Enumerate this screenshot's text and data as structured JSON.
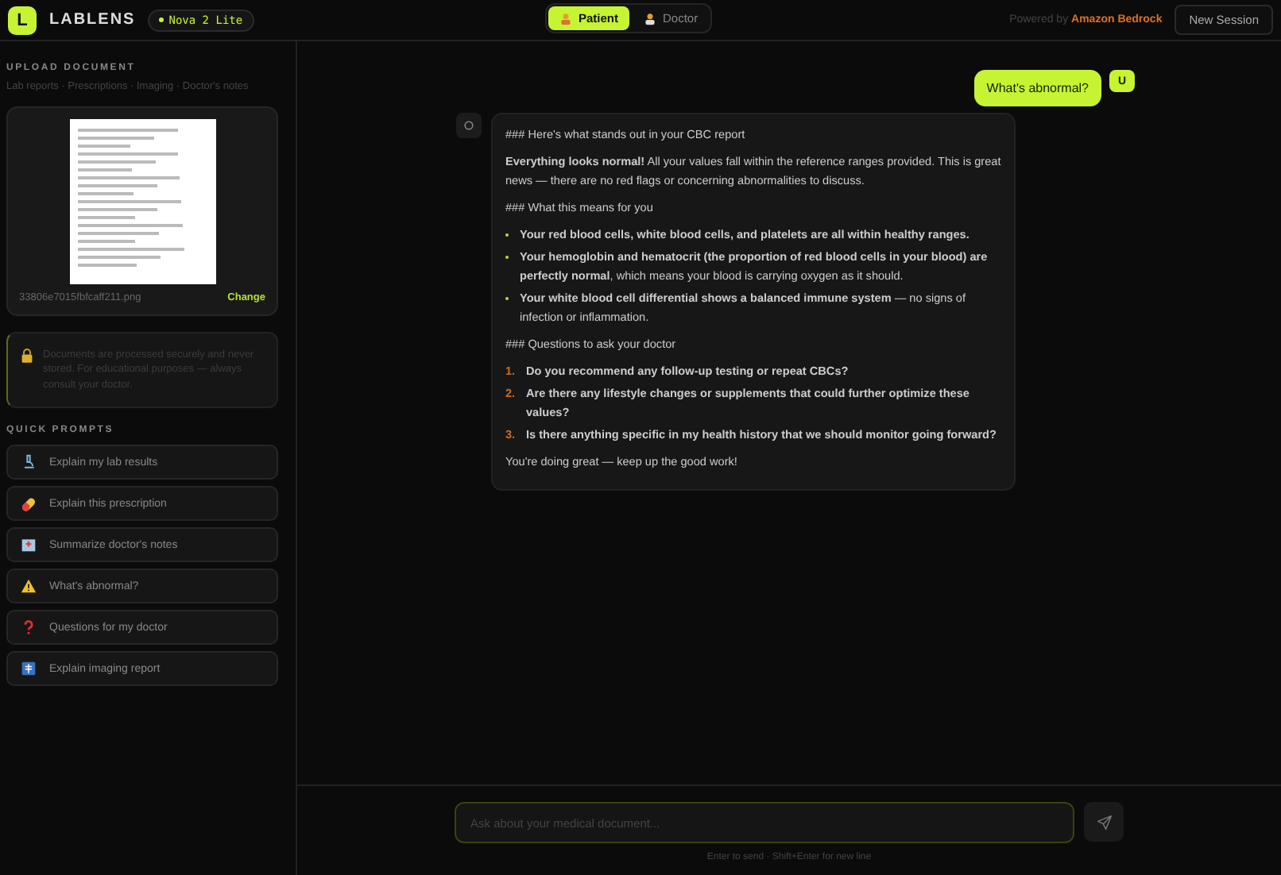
{
  "header": {
    "logo_letter": "L",
    "brand": "LABLENS",
    "model_badge": "Nova 2 Lite",
    "mode_tabs": [
      {
        "label": "Patient",
        "kind": "patient",
        "selected": true
      },
      {
        "label": "Doctor",
        "kind": "doctor",
        "selected": false
      }
    ],
    "powered_prefix": "Powered by",
    "powered_name": "Amazon Bedrock",
    "new_session": "New Session"
  },
  "sidebar": {
    "upload_title": "UPLOAD DOCUMENT",
    "upload_subtitle": "Lab reports · Prescriptions · Imaging · Doctor's notes",
    "file": {
      "name": "33806e7015fbfcaff211.png",
      "action": "Change"
    },
    "notice": "Documents are processed securely and never stored. For educational purposes — always consult your doctor.",
    "quick_prompts_title": "QUICK PROMPTS",
    "quick_prompts": [
      {
        "label": "Explain my lab results",
        "kind": "microscope"
      },
      {
        "label": "Explain this prescription",
        "kind": "pill"
      },
      {
        "label": "Summarize doctor's notes",
        "kind": "hospital"
      },
      {
        "label": "What's abnormal?",
        "kind": "warning"
      },
      {
        "label": "Questions for my doctor",
        "kind": "question"
      },
      {
        "label": "Explain imaging report",
        "kind": "xray"
      }
    ]
  },
  "messages": [
    {
      "kind": "user",
      "avatar": "U",
      "text": "What's abnormal?"
    },
    {
      "kind": "assistant",
      "blocks": [
        {
          "kind": "paragraph",
          "text": "### Here's what stands out in your CBC report"
        },
        {
          "kind": "paragraph",
          "text": "**Everything looks normal!** All your values fall within the reference ranges provided. This is great news — there are no red flags or concerning abnormalities to discuss."
        },
        {
          "kind": "paragraph",
          "text": "### What this means for you"
        },
        {
          "kind": "bullets",
          "items": [
            "**Your red blood cells, white blood cells, and platelets are all within healthy ranges.**",
            "**Your hemoglobin and hematocrit (the proportion of red blood cells in your blood) are perfectly normal**, which means your blood is carrying oxygen as it should.",
            "**Your white blood cell differential shows a balanced immune system** — no signs of infection or inflammation."
          ]
        },
        {
          "kind": "paragraph",
          "text": "### Questions to ask your doctor"
        },
        {
          "kind": "numbered",
          "items": [
            {
              "num": "1.",
              "text": "Do you recommend any follow-up testing or repeat CBCs?"
            },
            {
              "num": "2.",
              "text": "Are there any lifestyle changes or supplements that could further optimize these values?"
            },
            {
              "num": "3.",
              "text": "Is there anything specific in my health history that we should monitor going forward?"
            }
          ]
        },
        {
          "kind": "paragraph",
          "text": "You're doing great — keep up the good work!"
        }
      ]
    }
  ],
  "composer": {
    "placeholder": "Ask about your medical document...",
    "hint": "Enter to send · Shift+Enter for new line"
  }
}
